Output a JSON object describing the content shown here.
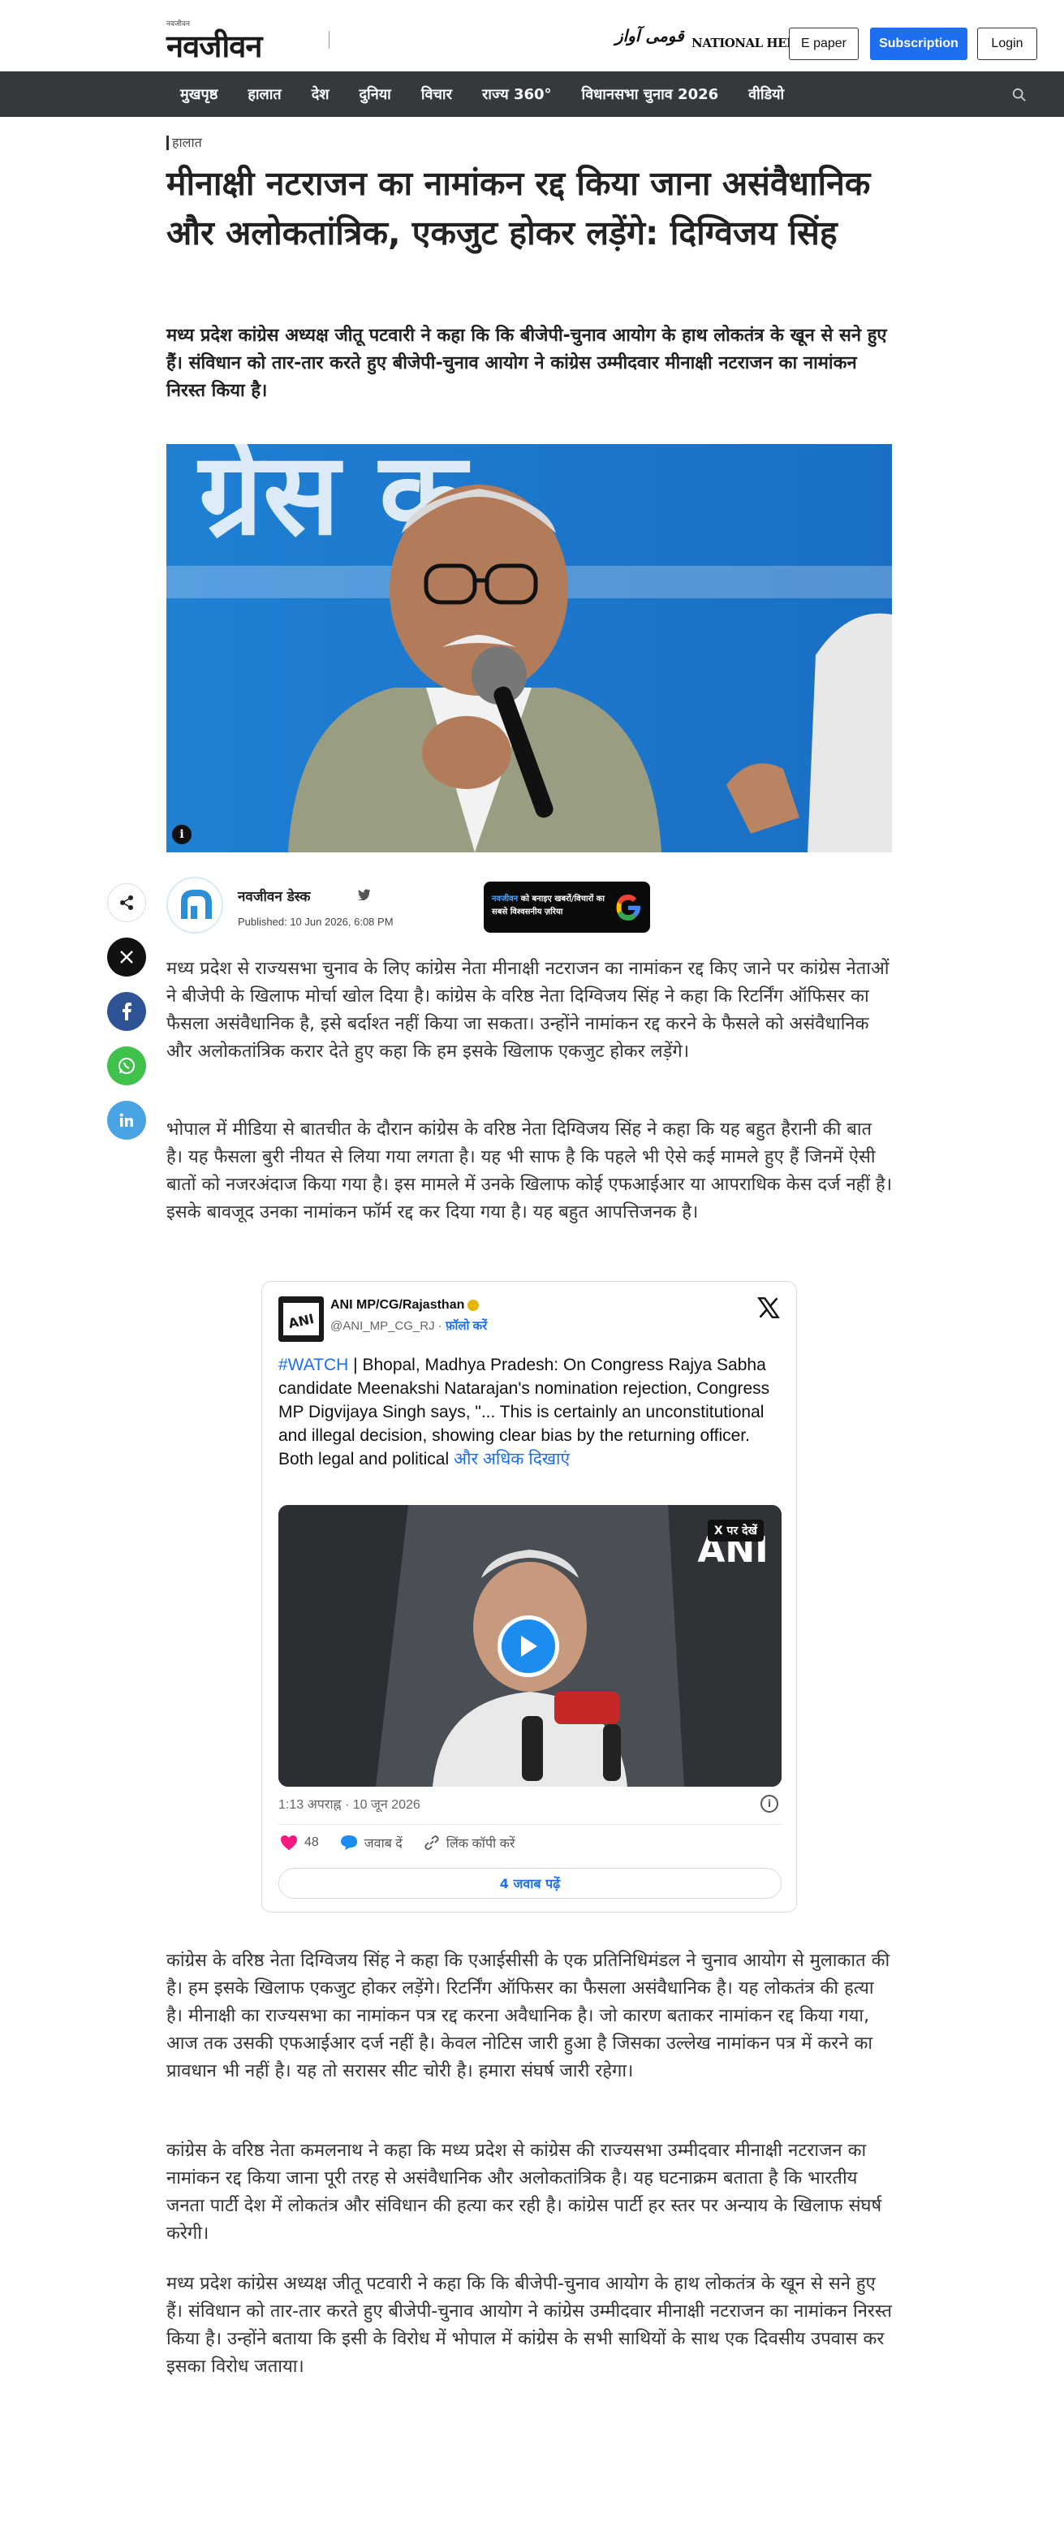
{
  "header": {
    "logo_sup": "नवजीवन",
    "logo": "नवजीवन",
    "partner_qaumi": "قومی آواز",
    "partner_nh": "NATIONAL HERALD",
    "epaper": "E paper",
    "subscription": "Subscription",
    "login": "Login"
  },
  "nav": {
    "items": [
      "मुखपृष्ठ",
      "हालात",
      "देश",
      "दुनिया",
      "विचार",
      "राज्य 360°",
      "विधानसभा चुनाव 2026",
      "वीडियो"
    ]
  },
  "article": {
    "section": "हालात",
    "headline": "मीनाक्षी नटराजन का नामांकन रद्द किया जाना असंवैधानिक और अलोकतांत्रिक, एकजुट होकर लड़ेंगे: दिग्विजय सिंह",
    "dek": "मध्य प्रदेश कांग्रेस अध्यक्ष जीतू पटवारी ने कहा कि कि बीजेपी-चुनाव आयोग के हाथ लोकतंत्र के खून से सने हुए हैं। संविधान को तार-तार करते हुए बीजेपी-चुनाव आयोग ने कांग्रेस उम्मीदवार मीनाक्षी नटराजन का नामांकन निरस्त किया है।",
    "author": "नवजीवन डेस्क",
    "published": "Published: 10 Jun 2026, 6:08 PM",
    "gbadge_highlight": "नवजीवन",
    "gbadge_text": " को बनाइए खबरों/विचारों का सबसे विश्वसनीय ज़रिया",
    "paragraphs": [
      "मध्य प्रदेश से राज्यसभा चुनाव के लिए कांग्रेस नेता मीनाक्षी नटराजन का नामांकन रद्द किए जाने पर कांग्रेस नेताओं ने बीजेपी के खिलाफ मोर्चा खोल दिया है। कांग्रेस के वरिष्ठ नेता दिग्विजय सिंह ने कहा कि रिटर्निंग ऑफिसर का फैसला असंवैधानिक है, इसे बर्दाश्त नहीं किया जा सकता। उन्होंने नामांकन रद्द करने के फैसले को असंवैधानिक और अलोकतांत्रिक करार देते हुए कहा कि हम इसके खिलाफ एकजुट होकर लड़ेंगे।",
      "भोपाल में मीडिया से बातचीत के दौरान कांग्रेस के वरिष्ठ नेता दिग्विजय सिंह ने कहा कि यह बहुत हैरानी की बात है। यह फैसला बुरी नीयत से लिया गया लगता है। यह भी साफ है कि पहले भी ऐसे कई मामले हुए हैं जिनमें ऐसी बातों को नजरअंदाज किया गया है। इस मामले में उनके खिलाफ कोई एफआईआर या आपराधिक केस दर्ज नहीं है। इसके बावजूद उनका नामांकन फॉर्म रद्द कर दिया गया है। यह बहुत आपत्तिजनक है।",
      "कांग्रेस के वरिष्ठ नेता दिग्विजय सिंह ने कहा कि एआईसीसी के एक प्रतिनिधिमंडल ने चुनाव आयोग से मुलाकात की है। हम इसके खिलाफ एकजुट होकर लड़ेंगे। रिटर्निंग ऑफिसर का फैसला असंवैधानिक है। यह लोकतंत्र की हत्या है। मीनाक्षी का राज्यसभा का नामांकन पत्र रद्द करना अवैधानिक है। जो कारण बताकर नामांकन रद्द किया गया, आज तक उसकी एफआईआर दर्ज नहीं है। केवल नोटिस जारी हुआ है जिसका उल्लेख नामांकन पत्र में करने का प्रावधान भी नहीं है। यह तो सरासर सीट चोरी है। हमारा संघर्ष जारी रहेगा।",
      "कांग्रेस के वरिष्ठ नेता कमलनाथ ने कहा कि मध्य प्रदेश से कांग्रेस की राज्यसभा उम्मीदवार मीनाक्षी नटराजन का नामांकन रद्द किया जाना पूरी तरह से असंवैधानिक और अलोकतांत्रिक है। यह घटनाक्रम बताता है कि भारतीय जनता पार्टी देश में लोकतंत्र और संविधान की हत्या कर रही है। कांग्रेस पार्टी हर स्तर पर अन्याय के खिलाफ संघर्ष करेगी।",
      "मध्य प्रदेश कांग्रेस अध्यक्ष जीतू पटवारी ने कहा कि कि बीजेपी-चुनाव आयोग के हाथ लोकतंत्र के खून से सने हुए हैं। संविधान को तार-तार करते हुए बीजेपी-चुनाव आयोग ने कांग्रेस उम्मीदवार मीनाक्षी नटराजन का नामांकन निरस्त किया है। उन्होंने बताया कि इसी के विरोध में भोपाल में कांग्रेस के सभी साथियों के साथ एक दिवसीय उपवास कर इसका विरोध जताया।"
    ]
  },
  "tweet": {
    "name": "ANI MP/CG/Rajasthan",
    "handle": "@ANI_MP_CG_RJ",
    "dot": " · ",
    "follow": "फ़ॉलो करें",
    "hashtag": "#WATCH",
    "text": " | Bhopal, Madhya Pradesh: On Congress Rajya Sabha candidate Meenakshi Natarajan's nomination rejection, Congress MP Digvijaya Singh says, \"... This is certainly an unconstitutional and illegal decision, showing clear bias by the returning officer. Both legal and political ",
    "more": "और अधिक दिखाएं",
    "watch_on_x": "X पर देखें",
    "media_logo": "ANI",
    "time": "1:13 अपराह्न · 10 जून 2026",
    "likes": "48",
    "reply": "जवाब दें",
    "copy_link": "लिंक कॉपी करें",
    "read_replies": "4 जवाब पढ़ें"
  },
  "colors": {
    "nav_bg": "#35393d",
    "accent": "#1d6ef0"
  }
}
